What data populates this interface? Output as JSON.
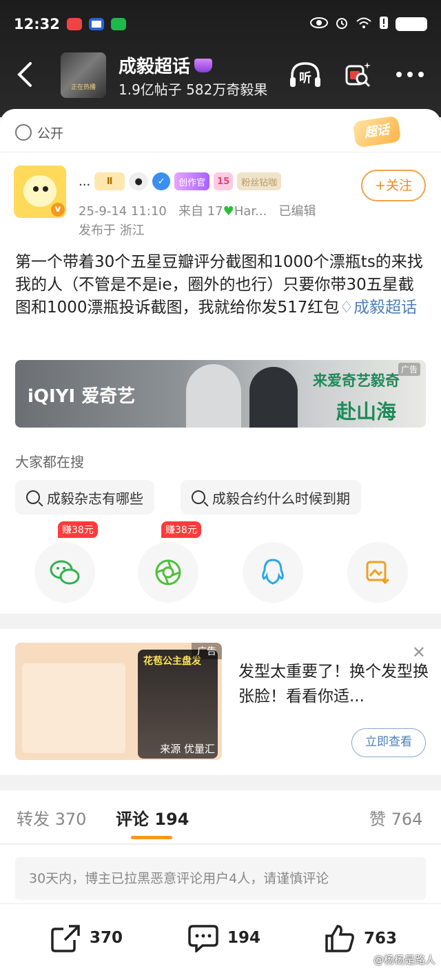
{
  "status_bar": {
    "time": "12:32",
    "battery_label": "",
    "icons": [
      "eye-icon",
      "alarm-icon",
      "wifi-icon",
      "alert-icon",
      "battery-icon"
    ]
  },
  "nav": {
    "topic_name": "成毅超话",
    "topic_stats": "1.9亿帖子 582万奇毅果",
    "listen_label": "听",
    "cover_text": "正在热播"
  },
  "post": {
    "visibility": "公开",
    "chaohua_tag": "超话",
    "username": "...",
    "badges": {
      "crown": "Ⅱ",
      "creator": "创作官",
      "level": "15",
      "fan": "粉丝钻咖"
    },
    "verified_mark": "v",
    "follow_label": "+关注",
    "time": "25-9-14 11:10",
    "source_prefix": "来自 17",
    "source_suffix": "Har...",
    "edited": "已编辑",
    "location": "发布于 浙江",
    "text": "第一个带着30个五星豆瓣评分截图和1000个漂瓶ts的来找我的人（不管是不是ie，圈外的也行）只要你带30五星截图和1000漂瓶投诉截图，我就给你发517红包",
    "topic_link": "成毅超话"
  },
  "banner_ad": {
    "brand": "iQIYI 爱奇艺",
    "slogan_line1": "来爱奇艺",
    "slogan_highlight": "毅奇",
    "slogan_line2": "赴山海",
    "ad_tag": "广告"
  },
  "search": {
    "title": "大家都在搜",
    "chips": [
      "成毅杂志有哪些",
      "成毅合约什么时候到期"
    ]
  },
  "share": {
    "items": [
      {
        "name": "wechat",
        "earn": "赚38元"
      },
      {
        "name": "moments",
        "earn": "赚38元"
      },
      {
        "name": "qq",
        "earn": ""
      },
      {
        "name": "save-image",
        "earn": ""
      }
    ]
  },
  "ad_card": {
    "tag": "广告",
    "source": "来源 优量汇",
    "headline": "花苞公主盘发",
    "text": "发型太重要了！换个发型换张脸！看看你适...",
    "cta": "立即查看",
    "close": "✕"
  },
  "tabs": {
    "repost_label": "转发",
    "repost_count": "370",
    "comment_label": "评论",
    "comment_count": "194",
    "like_label": "赞",
    "like_count": "764"
  },
  "notice": "30天内，博主已拉黑恶意评论用户4人，请谨慎评论",
  "bottom_bar": {
    "repost": "370",
    "comment": "194",
    "like": "763"
  },
  "watermark": "@杨杨是路人",
  "colors": {
    "accent": "#f39a1d",
    "link": "#4f7fb8",
    "header_bg": "#1c1c1c"
  }
}
